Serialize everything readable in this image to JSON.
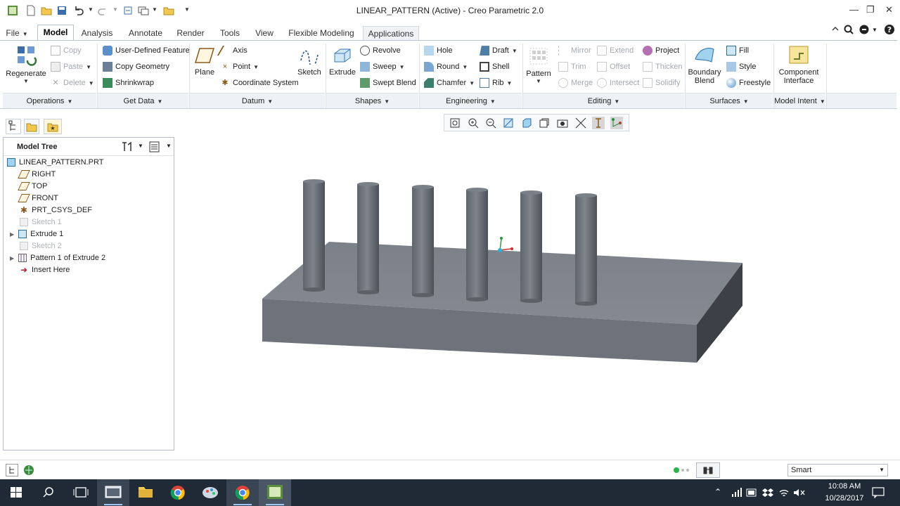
{
  "window": {
    "title": "LINEAR_PATTERN (Active) - Creo Parametric 2.0"
  },
  "tabs": [
    {
      "label": "File"
    },
    {
      "label": "Model"
    },
    {
      "label": "Analysis"
    },
    {
      "label": "Annotate"
    },
    {
      "label": "Render"
    },
    {
      "label": "Tools"
    },
    {
      "label": "View"
    },
    {
      "label": "Flexible Modeling"
    },
    {
      "label": "Applications"
    }
  ],
  "ribbon": {
    "operations": {
      "regenerate": "Regenerate",
      "copy": "Copy",
      "paste": "Paste",
      "delete": "Delete",
      "group": "Operations"
    },
    "get_data": {
      "udf": "User-Defined Feature",
      "copy_geometry": "Copy Geometry",
      "shrinkwrap": "Shrinkwrap",
      "group": "Get Data"
    },
    "datum": {
      "plane": "Plane",
      "axis": "Axis",
      "point": "Point",
      "csys": "Coordinate System",
      "sketch": "Sketch",
      "group": "Datum"
    },
    "shapes": {
      "extrude": "Extrude",
      "revolve": "Revolve",
      "sweep": "Sweep",
      "swept_blend": "Swept Blend",
      "group": "Shapes"
    },
    "engineering": {
      "hole": "Hole",
      "round": "Round",
      "chamfer": "Chamfer",
      "draft": "Draft",
      "shell": "Shell",
      "rib": "Rib",
      "group": "Engineering"
    },
    "editing": {
      "pattern": "Pattern",
      "mirror": "Mirror",
      "trim": "Trim",
      "merge": "Merge",
      "extend": "Extend",
      "offset": "Offset",
      "intersect": "Intersect",
      "project": "Project",
      "thicken": "Thicken",
      "solidify": "Solidify",
      "group": "Editing"
    },
    "surfaces": {
      "boundary_blend_1": "Boundary",
      "boundary_blend_2": "Blend",
      "fill": "Fill",
      "style": "Style",
      "freestyle": "Freestyle",
      "group": "Surfaces"
    },
    "model_intent": {
      "component_interface_1": "Component",
      "component_interface_2": "Interface",
      "group": "Model Intent"
    }
  },
  "model_tree": {
    "header": "Model Tree",
    "items": [
      {
        "label": "LINEAR_PATTERN.PRT"
      },
      {
        "label": "RIGHT"
      },
      {
        "label": "TOP"
      },
      {
        "label": "FRONT"
      },
      {
        "label": "PRT_CSYS_DEF"
      },
      {
        "label": "Sketch 1"
      },
      {
        "label": "Extrude 1"
      },
      {
        "label": "Sketch 2"
      },
      {
        "label": "Pattern 1 of Extrude 2"
      },
      {
        "label": "Insert Here"
      }
    ]
  },
  "statusbar": {
    "filter": "Smart"
  },
  "taskbar": {
    "time": "10:08 AM",
    "date": "10/28/2017"
  },
  "colors": {
    "model_top": "#8a8f96",
    "model_side": "#6f747c",
    "model_dark": "#3f4349",
    "cylinder": "#70767e"
  }
}
